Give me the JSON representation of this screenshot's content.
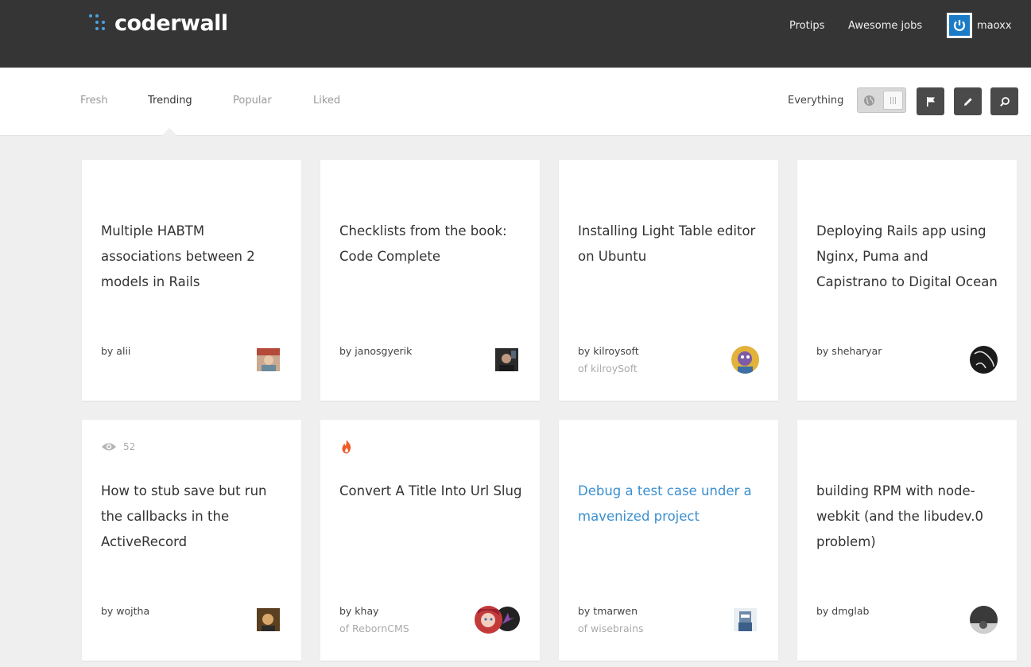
{
  "header": {
    "logo_text": "coderwall",
    "nav": [
      "Protips",
      "Awesome jobs"
    ],
    "username": "maoxx"
  },
  "subnav": {
    "tabs": [
      "Fresh",
      "Trending",
      "Popular",
      "Liked"
    ],
    "active_tab": "Trending",
    "scope_label": "Everything"
  },
  "icons": {
    "toggle": "globe-icon",
    "buttons": [
      "flag-icon",
      "pencil-icon",
      "search-icon"
    ]
  },
  "colors": {
    "accent": "#3a8fce",
    "topbar": "#353535",
    "hot": "#f15a29"
  },
  "cards": [
    {
      "title": "Multiple HABTM associations between 2 models in Rails",
      "author": "by alii",
      "team": ""
    },
    {
      "title": "Checklists from the book: Code Complete",
      "author": "by janosgyerik",
      "team": ""
    },
    {
      "title": "Installing Light Table editor on Ubuntu",
      "author": "by kilroysoft",
      "team": "of kilroySoft"
    },
    {
      "title": "Deploying Rails app using Nginx, Puma and Capistrano to Digital Ocean",
      "author": "by sheharyar",
      "team": ""
    },
    {
      "title": "How to stub save but run the callbacks in the ActiveRecord",
      "author": "by wojtha",
      "team": "",
      "views": "52"
    },
    {
      "title": "Convert A Title Into Url Slug",
      "author": "by khay",
      "team": "of RebornCMS",
      "hot": true
    },
    {
      "title": "Debug a test case under a mavenized project",
      "author": "by tmarwen",
      "team": "of wisebrains"
    },
    {
      "title": "building RPM with node-webkit (and the libudev.0 problem)",
      "author": "by dmglab",
      "team": ""
    }
  ]
}
